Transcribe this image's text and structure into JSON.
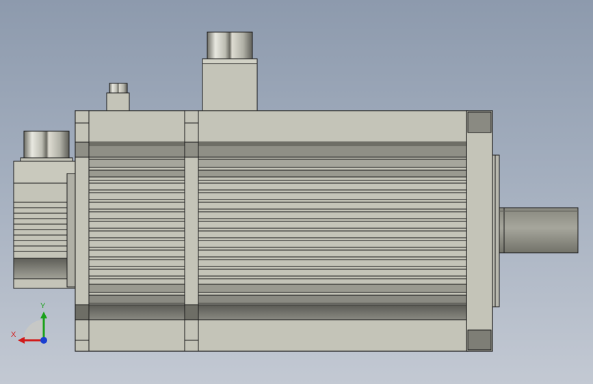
{
  "viewport": {
    "background_top": "#8d9aad",
    "background_bottom": "#c3c9d3"
  },
  "model": {
    "part_color": "#c4c4b8",
    "edge_color": "#1a1a1a",
    "shade_color": "#808078"
  },
  "triad": {
    "x_label": "X",
    "y_label": "Y",
    "x_color": "#d11a1a",
    "y_color": "#1aa11a",
    "z_color": "#1a3fd1"
  }
}
